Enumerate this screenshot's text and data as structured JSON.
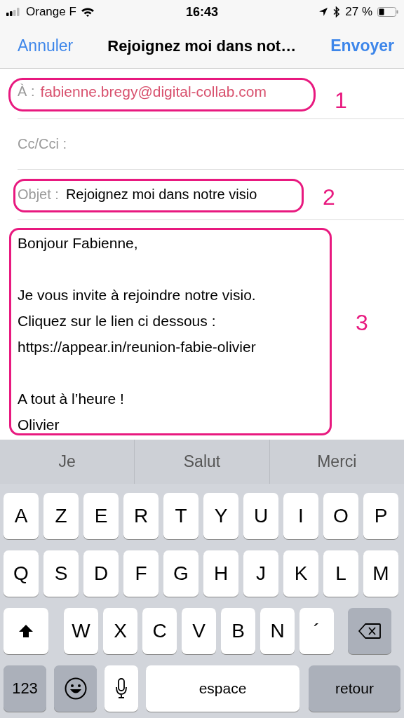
{
  "status_bar": {
    "carrier": "Orange F",
    "time": "16:43",
    "battery": "27 %"
  },
  "nav": {
    "cancel": "Annuler",
    "title": "Rejoignez moi dans not…",
    "send": "Envoyer"
  },
  "fields": [
    {
      "label": "À :",
      "value": "fabienne.bregy@digital-collab.com",
      "kind": "recipient"
    },
    {
      "label": "Cc/Cci :",
      "kind": "empty"
    },
    {
      "label": "Objet :",
      "value": "Rejoignez moi dans notre visio",
      "kind": "subject"
    }
  ],
  "body": [
    [
      "Bonjour Fabienne,"
    ],
    [
      "Je vous invite à rejoindre notre visio.",
      "Cliquez sur le lien ci dessous :",
      "https://appear.in/reunion-fabie-olivier"
    ],
    [
      "A tout à l’heure !",
      "Olivier"
    ]
  ],
  "annotations": [
    {
      "label": "1"
    },
    {
      "label": "2"
    },
    {
      "label": "3"
    }
  ],
  "suggestions": [
    "Je",
    "Salut",
    "Merci"
  ],
  "keyboard": [
    [
      {
        "kind": "letter",
        "label": "A"
      },
      {
        "kind": "letter",
        "label": "Z"
      },
      {
        "kind": "letter",
        "label": "E"
      },
      {
        "kind": "letter",
        "label": "R"
      },
      {
        "kind": "letter",
        "label": "T"
      },
      {
        "kind": "letter",
        "label": "Y"
      },
      {
        "kind": "letter",
        "label": "U"
      },
      {
        "kind": "letter",
        "label": "I"
      },
      {
        "kind": "letter",
        "label": "O"
      },
      {
        "kind": "letter",
        "label": "P"
      }
    ],
    [
      {
        "kind": "letter",
        "label": "Q"
      },
      {
        "kind": "letter",
        "label": "S"
      },
      {
        "kind": "letter",
        "label": "D"
      },
      {
        "kind": "letter",
        "label": "F"
      },
      {
        "kind": "letter",
        "label": "G"
      },
      {
        "kind": "letter",
        "label": "H"
      },
      {
        "kind": "letter",
        "label": "J"
      },
      {
        "kind": "letter",
        "label": "K"
      },
      {
        "kind": "letter",
        "label": "L"
      },
      {
        "kind": "letter",
        "label": "M"
      }
    ],
    [
      {
        "kind": "shift"
      },
      {
        "kind": "letter",
        "label": "W"
      },
      {
        "kind": "letter",
        "label": "X"
      },
      {
        "kind": "letter",
        "label": "C"
      },
      {
        "kind": "letter",
        "label": "V"
      },
      {
        "kind": "letter",
        "label": "B"
      },
      {
        "kind": "letter",
        "label": "N"
      },
      {
        "kind": "letter",
        "label": "´"
      },
      {
        "kind": "delete"
      }
    ],
    [
      {
        "kind": "numbers",
        "label": "123"
      },
      {
        "kind": "emoji"
      },
      {
        "kind": "mic"
      },
      {
        "kind": "space",
        "label": "espace"
      },
      {
        "kind": "return",
        "label": "retour"
      }
    ]
  ]
}
